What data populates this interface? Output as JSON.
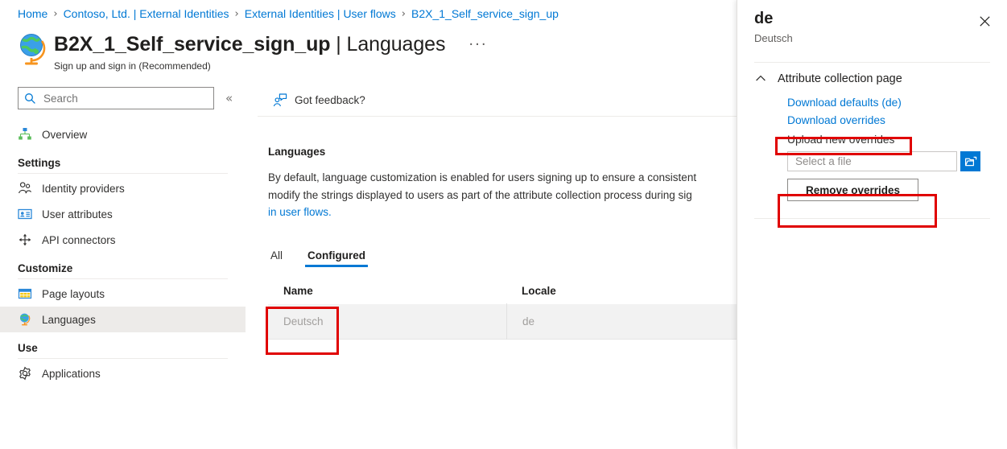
{
  "breadcrumb": {
    "separator": "›",
    "items": [
      {
        "label": "Home"
      },
      {
        "label": "Contoso, Ltd. | External Identities"
      },
      {
        "label": "External Identities | User flows"
      },
      {
        "label": "B2X_1_Self_service_sign_up"
      }
    ]
  },
  "header": {
    "title_main": "B2X_1_Self_service_sign_up",
    "title_separator": " | ",
    "title_section": "Languages",
    "subtitle": "Sign up and sign in (Recommended)",
    "more_label": "···",
    "globe_icon": "globe-icon"
  },
  "sidebar": {
    "search": {
      "placeholder": "Search",
      "value": "",
      "icon": "search-icon"
    },
    "collapse_icon": "chevron-double-left-icon",
    "top_items": [
      {
        "label": "Overview",
        "icon": "overview-hierarchy-icon",
        "selected": false
      }
    ],
    "sections": [
      {
        "title": "Settings",
        "items": [
          {
            "label": "Identity providers",
            "icon": "people-icon",
            "selected": false
          },
          {
            "label": "User attributes",
            "icon": "id-card-icon",
            "selected": false
          },
          {
            "label": "API connectors",
            "icon": "connector-arrows-icon",
            "selected": false
          }
        ]
      },
      {
        "title": "Customize",
        "items": [
          {
            "label": "Page layouts",
            "icon": "table-layout-icon",
            "selected": false
          },
          {
            "label": "Languages",
            "icon": "globe-icon",
            "selected": true
          }
        ]
      },
      {
        "title": "Use",
        "items": [
          {
            "label": "Applications",
            "icon": "gear-icon",
            "selected": false
          }
        ]
      }
    ]
  },
  "main": {
    "commandbar": {
      "feedback_label": "Got feedback?",
      "feedback_icon": "feedback-person-icon"
    },
    "section_title": "Languages",
    "description_line1": "By default, language customization is enabled for users signing up to ensure a consistent",
    "description_line2": "modify the strings displayed to users as part of the attribute collection process during sig",
    "description_line3_link": "in user flows.",
    "tabs": [
      {
        "label": "All",
        "active": false
      },
      {
        "label": "Configured",
        "active": true
      }
    ],
    "table": {
      "columns": [
        "Name",
        "Locale"
      ],
      "rows": [
        {
          "name": "Deutsch",
          "locale": "de"
        }
      ]
    }
  },
  "panel": {
    "title": "de",
    "subtitle": "Deutsch",
    "close_icon": "close-icon",
    "accordion": {
      "title": "Attribute collection page",
      "expanded": true,
      "chevron_icon": "chevron-up-icon"
    },
    "download_defaults_label": "Download defaults (de)",
    "download_overrides_label": "Download overrides",
    "upload_label": "Upload new overrides",
    "file_input": {
      "placeholder": "Select a file",
      "value": ""
    },
    "browse_icon": "folder-open-icon",
    "remove_overrides_label": "Remove overrides"
  },
  "annotations": {
    "highlight_color": "#e00000",
    "boxes": [
      {
        "name": "deutsch-row-highlight"
      },
      {
        "name": "download-overrides-highlight"
      },
      {
        "name": "remove-overrides-highlight"
      }
    ]
  }
}
